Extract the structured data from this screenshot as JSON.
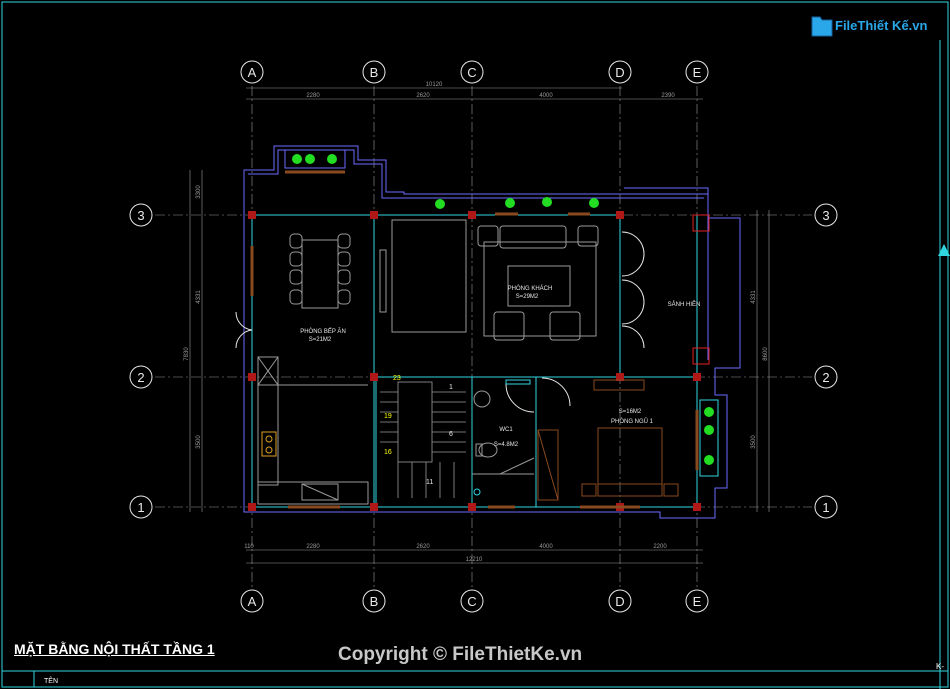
{
  "logo_text": "FileThiết Kế.vn",
  "plan_title": "MẶT BẰNG NỘI THẤT TẦNG 1",
  "copyright": "Copyright © FileThietKe.vn",
  "title_block_label": "TÊN",
  "corner_label": "K-",
  "grid_letters": [
    "A",
    "B",
    "C",
    "D",
    "E"
  ],
  "grid_numbers": [
    "3",
    "2",
    "1"
  ],
  "dims_top": {
    "total": "10120",
    "segments": [
      "2280",
      "2620",
      "4000",
      "2390"
    ]
  },
  "dims_bottom": {
    "total": "12210",
    "segments": [
      "110",
      "2280",
      "2620",
      "4000",
      "2200"
    ]
  },
  "dims_left": {
    "total": "7830",
    "segments": [
      "3300",
      "4331",
      "3500"
    ]
  },
  "dims_right": {
    "total": "8600",
    "segments": [
      "4331",
      "3500"
    ]
  },
  "rooms": {
    "kitchen": {
      "name": "PHÒNG BẾP ĂN",
      "area": "S=21M2"
    },
    "living": {
      "name": "PHÒNG KHÁCH",
      "area": "S=29M2"
    },
    "porch": {
      "name": "SẢNH HIÊN"
    },
    "wc": {
      "name": "WC1",
      "area": "S=4.8M2"
    },
    "bedroom": {
      "name": "PHÒNG NGỦ 1",
      "area": "S=16M2"
    }
  },
  "stair_numbers": [
    "23",
    "1",
    "19",
    "6",
    "16",
    "11"
  ],
  "colors": {
    "background": "#000000",
    "wall": "#6c6cff",
    "wall_inner": "#2fd6e0",
    "furniture": "#9a9a9a",
    "grid": "#c8c8c8",
    "column": "#e02020",
    "plant": "#22dd22",
    "stair_num": "#ffff00",
    "door": "#e8e8e8"
  }
}
